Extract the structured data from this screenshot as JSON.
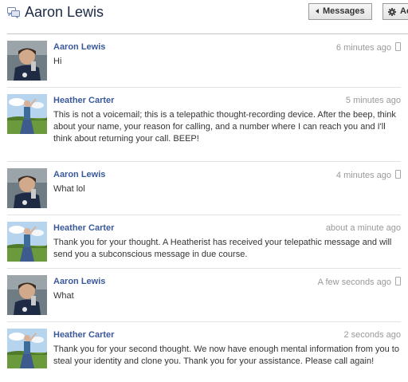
{
  "header": {
    "title": "Aaron Lewis",
    "messages_button": "Messages",
    "actions_button": "Actions"
  },
  "messages": [
    {
      "sender": "Aaron Lewis",
      "time": "6 minutes ago",
      "mobile": true,
      "text": "Hi"
    },
    {
      "sender": "Heather Carter",
      "time": "5 minutes ago",
      "mobile": false,
      "text": "This is not a voicemail; this is a telepathic thought-recording device. After the beep, think about your name, your reason for calling, and a number where I can reach you and I'll think about returning your call. BEEP!"
    },
    {
      "sender": "Aaron Lewis",
      "time": "4 minutes ago",
      "mobile": true,
      "text": "What lol"
    },
    {
      "sender": "Heather Carter",
      "time": "about a minute ago",
      "mobile": false,
      "text": "Thank you for your thought. A Heatherist has received your telepathic message and will send you a subconscious message in due course."
    },
    {
      "sender": "Aaron Lewis",
      "time": "A few seconds ago",
      "mobile": true,
      "text": "What"
    },
    {
      "sender": "Heather Carter",
      "time": "2 seconds ago",
      "mobile": false,
      "text": "Thank you for your second thought. We now have enough mental information from you to steal your identity and clone you. Thank you for your assistance. Please call again!"
    }
  ],
  "colors": {
    "link_blue": "#3b5998",
    "title_dark": "#1c2a47",
    "timestamp_gray": "#999999",
    "divider": "#c4c4c4"
  },
  "icons": {
    "header": "chat-bubbles-icon",
    "messages_button": "left-triangle-icon",
    "actions_button": "gear-icon",
    "mobile": "mobile-phone-icon"
  }
}
